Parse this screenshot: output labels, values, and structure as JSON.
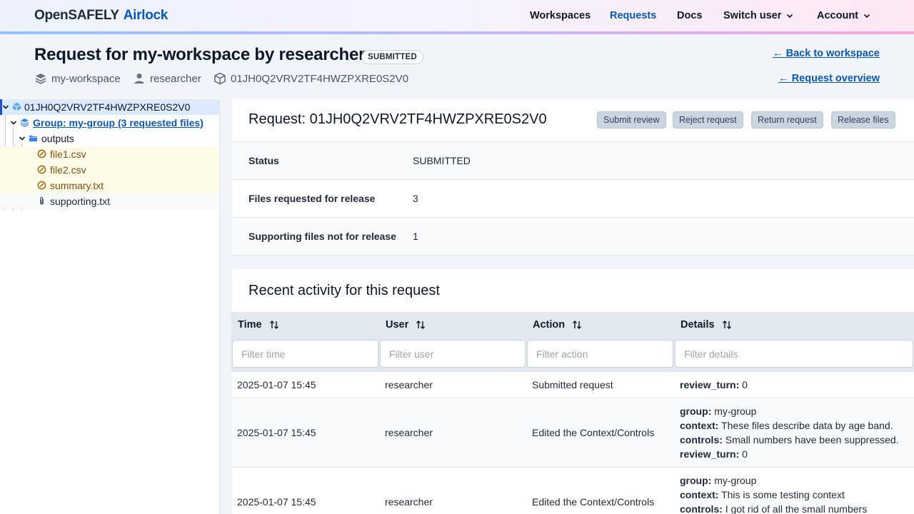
{
  "header": {
    "logo_part1": "OpenSAFELY",
    "logo_part2": "Airlock",
    "nav": [
      "Workspaces",
      "Requests",
      "Docs",
      "Switch user",
      "Account"
    ]
  },
  "page": {
    "title": "Request for my-workspace by researcher",
    "status_badge": "SUBMITTED",
    "meta": {
      "workspace": "my-workspace",
      "user": "researcher",
      "request_id": "01JH0Q2VRV2TF4HWZPXRE0S2V0"
    },
    "back_link": "← Back to workspace",
    "overview_link": "← Request overview"
  },
  "tree": {
    "root": "01JH0Q2VRV2TF4HWZPXRE0S2V0",
    "group": "Group: my-group (3 requested files)",
    "folder": "outputs",
    "files": [
      "file1.csv",
      "file2.csv",
      "summary.txt"
    ],
    "supporting": "supporting.txt"
  },
  "request_panel": {
    "title": "Request: 01JH0Q2VRV2TF4HWZPXRE0S2V0",
    "buttons": [
      "Submit review",
      "Reject request",
      "Return request",
      "Release files"
    ],
    "rows": [
      {
        "key": "Status",
        "value": "SUBMITTED"
      },
      {
        "key": "Files requested for release",
        "value": "3"
      },
      {
        "key": "Supporting files not for release",
        "value": "1"
      }
    ]
  },
  "activity": {
    "title": "Recent activity for this request",
    "columns": [
      "Time",
      "User",
      "Action",
      "Details"
    ],
    "filters": [
      "Filter time",
      "Filter user",
      "Filter action",
      "Filter details"
    ],
    "rows": [
      {
        "time": "2025-01-07 15:45",
        "user": "researcher",
        "action": "Submitted request",
        "details": [
          {
            "k": "review_turn:",
            "v": "0"
          }
        ]
      },
      {
        "time": "2025-01-07 15:45",
        "user": "researcher",
        "action": "Edited the Context/Controls",
        "details": [
          {
            "k": "group:",
            "v": "my-group"
          },
          {
            "k": "context:",
            "v": "These files describe data by age band."
          },
          {
            "k": "controls:",
            "v": "Small numbers have been suppressed."
          },
          {
            "k": "review_turn:",
            "v": "0"
          }
        ]
      },
      {
        "time": "2025-01-07 15:45",
        "user": "researcher",
        "action": "Edited the Context/Controls",
        "details": [
          {
            "k": "group:",
            "v": "my-group"
          },
          {
            "k": "context:",
            "v": "This is some testing context"
          },
          {
            "k": "controls:",
            "v": "I got rid of all the small numbers"
          }
        ]
      }
    ]
  },
  "colors": {
    "brand": "#0058be",
    "link": "#0b58b4",
    "selected": "#dbeafe",
    "requested": "#fefce8",
    "requested_text": "#854d0e"
  }
}
